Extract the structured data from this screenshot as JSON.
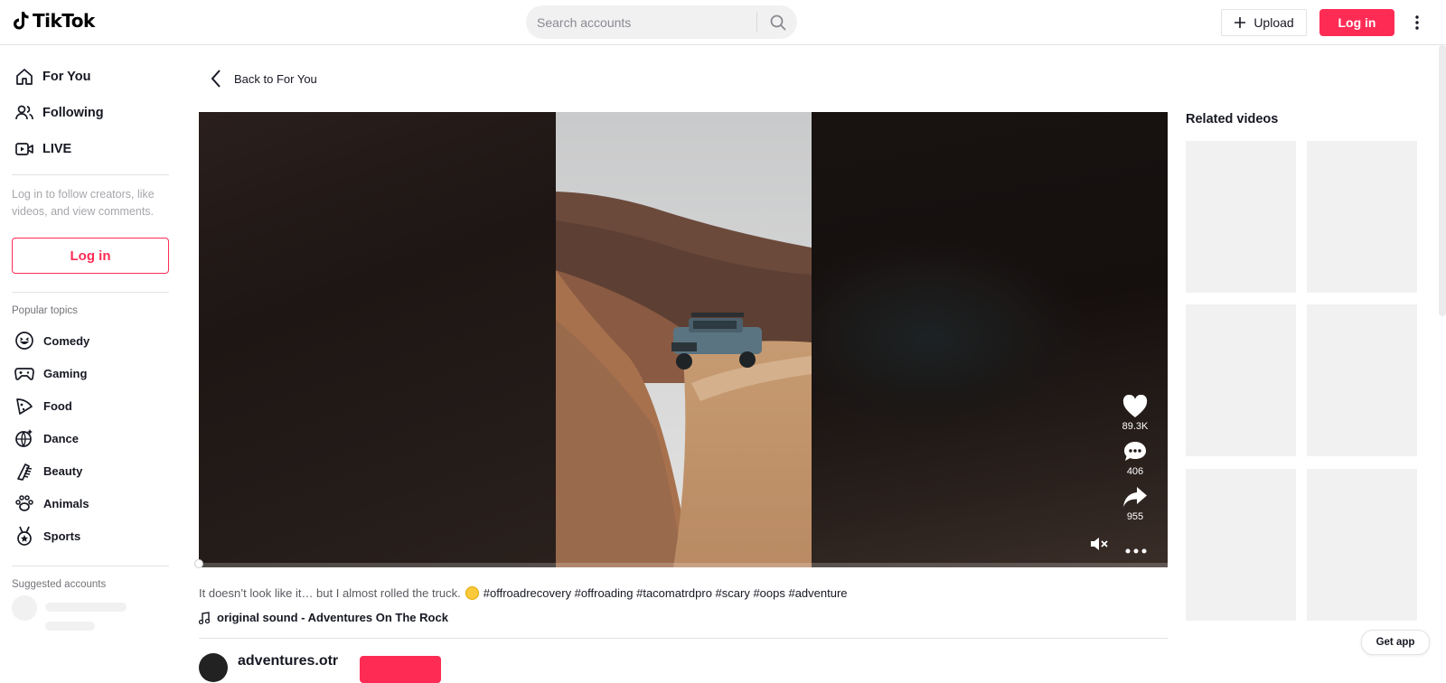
{
  "header": {
    "logo_text": "TikTok",
    "search_placeholder": "Search accounts",
    "upload_label": "Upload",
    "login_label": "Log in"
  },
  "sidebar": {
    "nav": [
      {
        "label": "For You",
        "icon": "home-icon"
      },
      {
        "label": "Following",
        "icon": "users-icon"
      },
      {
        "label": "LIVE",
        "icon": "live-icon"
      }
    ],
    "login_hint": "Log in to follow creators, like videos, and view comments.",
    "login_label": "Log in",
    "popular_title": "Popular topics",
    "topics": [
      {
        "label": "Comedy",
        "icon": "comedy-icon"
      },
      {
        "label": "Gaming",
        "icon": "gaming-icon"
      },
      {
        "label": "Food",
        "icon": "food-icon"
      },
      {
        "label": "Dance",
        "icon": "dance-icon"
      },
      {
        "label": "Beauty",
        "icon": "beauty-icon"
      },
      {
        "label": "Animals",
        "icon": "animals-icon"
      },
      {
        "label": "Sports",
        "icon": "sports-icon"
      }
    ],
    "suggested_title": "Suggested accounts"
  },
  "main": {
    "back_label": "Back to For You",
    "actions": {
      "likes": "89.3K",
      "comments": "406",
      "shares": "955"
    },
    "caption_text": "It doesn’t look like it… but I almost rolled the truck.",
    "hashtags": "#offroadrecovery #offroading #tacomatrdpro #scary #oops #adventure",
    "sound": "original sound - Adventures On The Rock",
    "author": "adventures.otr",
    "progress": 0
  },
  "related": {
    "title": "Related videos"
  },
  "get_app_label": "Get app",
  "colors": {
    "accent": "#fe2c55",
    "text": "#161823",
    "muted": "#a6a7ab"
  }
}
